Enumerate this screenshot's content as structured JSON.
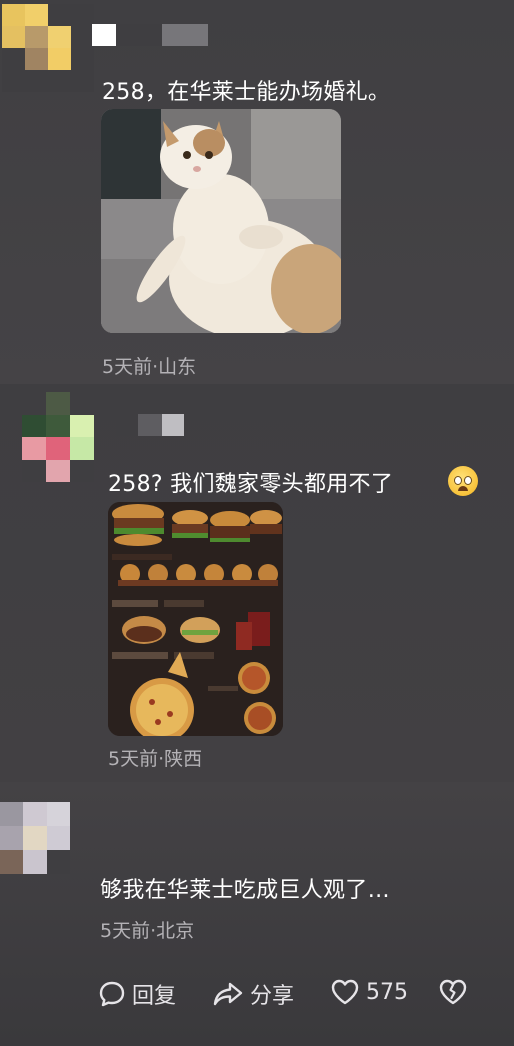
{
  "comments": [
    {
      "text": "258，在华莱士能办场婚礼。",
      "meta": "5天前·山东",
      "image": "cat-photo"
    },
    {
      "text": "258? 我们魏家零头都用不了",
      "meta": "5天前·陕西",
      "image": "menu-photo",
      "emoji": "crying-face-emoji"
    },
    {
      "text": "够我在华莱士吃成巨人观了…",
      "meta": "5天前·北京"
    }
  ],
  "actions": {
    "reply_label": "回复",
    "share_label": "分享",
    "like_count": "575"
  },
  "icons": [
    "reply-bubble-icon",
    "share-arrow-icon",
    "like-heart-icon",
    "dislike-broken-heart-icon"
  ]
}
